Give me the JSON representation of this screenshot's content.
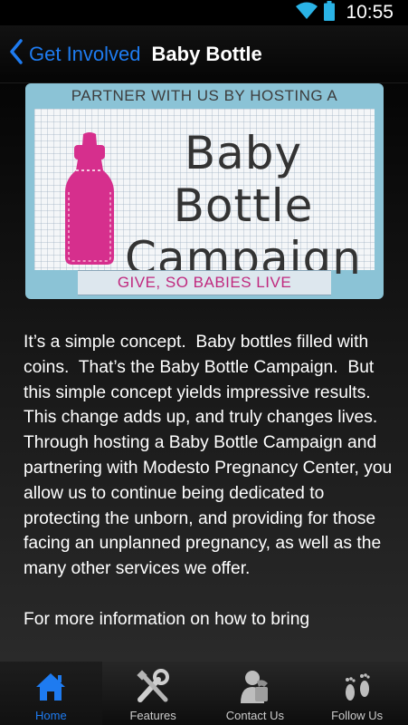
{
  "status_bar": {
    "time": "10:55",
    "icons": [
      "wifi-icon",
      "battery-icon"
    ]
  },
  "nav": {
    "back_label": "Get Involved",
    "title": "Baby Bottle"
  },
  "banner": {
    "top_text": "PARTNER WITH US BY HOSTING A",
    "title_line1": "Baby Bottle",
    "title_line2": "Campaign",
    "tagline": "GIVE, SO BABIES LIVE"
  },
  "body": {
    "paragraph1": "It’s a simple concept.  Baby bottles filled with coins.  That’s the Baby Bottle Campaign.  But this simple concept yields impressive results.  This change adds up, and truly changes lives.  Through hosting a Baby Bottle Campaign and partnering with Modesto Pregnancy Center, you allow us to continue being dedicated to protecting the unborn, and providing for those facing an unplanned pregnancy, as well as the many other services we offer.",
    "paragraph2": "For more information on how to bring"
  },
  "tabs": [
    {
      "label": "Home",
      "icon": "home-icon",
      "active": true
    },
    {
      "label": "Features",
      "icon": "tools-icon",
      "active": false
    },
    {
      "label": "Contact Us",
      "icon": "contact-icon",
      "active": false
    },
    {
      "label": "Follow Us",
      "icon": "footprints-icon",
      "active": false
    }
  ],
  "colors": {
    "accent": "#1e7bf0",
    "banner_blue": "#8bc3d6",
    "bottle_pink": "#d62f8d"
  }
}
